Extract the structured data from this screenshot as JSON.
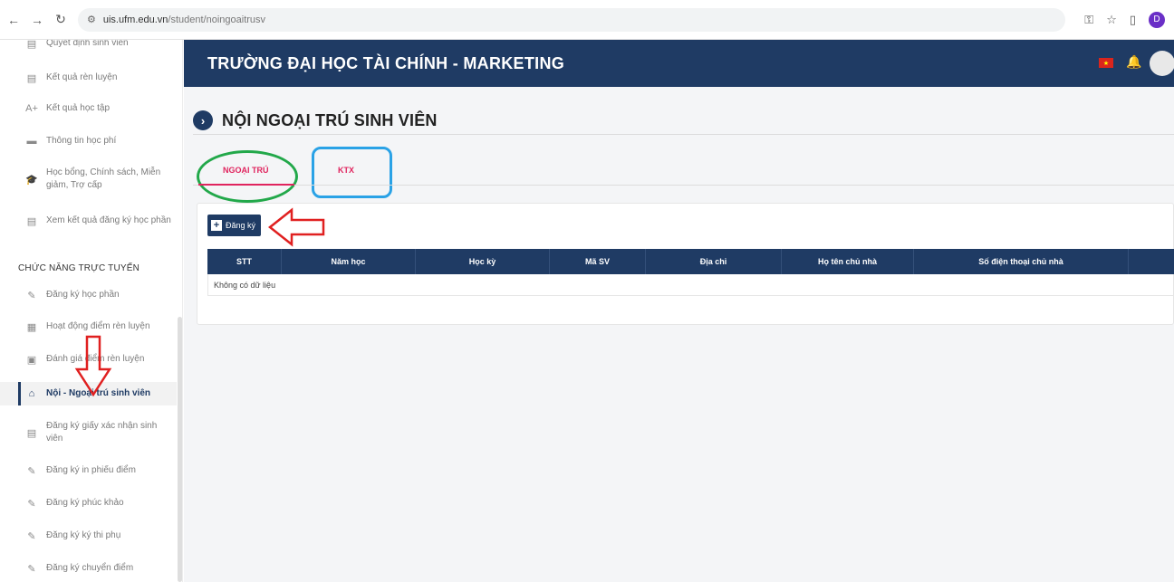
{
  "browser": {
    "url_host": "uis.ufm.edu.vn",
    "url_path": "/student/noingoaitrusv",
    "profile_initial": "D"
  },
  "header": {
    "title": "TRƯỜNG ĐẠI HỌC TÀI CHÍNH - MARKETING"
  },
  "sidebar": {
    "items_top": [
      {
        "label": "Quyết định sinh viên",
        "icon": "document-icon"
      },
      {
        "label": "Kết quả rèn luyện",
        "icon": "document-icon"
      },
      {
        "label": "Kết quả học tập",
        "icon": "text-a-plus-icon"
      },
      {
        "label": "Thông tin học phí",
        "icon": "card-icon"
      },
      {
        "label_line1": "Học bổng, Chính sách, Miễn",
        "label_line2": "giảm, Trợ cấp",
        "icon": "graduation-icon"
      },
      {
        "label": "Xem kết quả đăng ký học phần",
        "icon": "document-icon"
      }
    ],
    "section_title": "CHỨC NĂNG TRỰC TUYẾN",
    "items_online": [
      {
        "label": "Đăng ký học phần",
        "icon": "edit-icon"
      },
      {
        "label": "Hoạt động điểm rèn luyện",
        "icon": "users-icon"
      },
      {
        "label": "Đánh giá điểm rèn luyện",
        "icon": "document-icon"
      },
      {
        "label": "Nội - Ngoại trú sinh viên",
        "icon": "home-icon",
        "active": true
      },
      {
        "label_line1": "Đăng ký giấy xác nhận sinh",
        "label_line2": "viên",
        "icon": "document-plus-icon"
      },
      {
        "label": "Đăng ký in phiếu điểm",
        "icon": "edit-icon"
      },
      {
        "label": "Đăng ký phúc khảo",
        "icon": "edit-icon"
      },
      {
        "label": "Đăng ký ký thi phụ",
        "icon": "edit-icon"
      },
      {
        "label": "Đăng ký chuyển điểm",
        "icon": "edit-icon"
      }
    ]
  },
  "main": {
    "page_title": "NỘI NGOẠI TRÚ SINH VIÊN",
    "tabs": [
      {
        "label": "NGOẠI TRÚ",
        "active": true
      },
      {
        "label": "KTX",
        "active": false
      }
    ],
    "register_button": "Đăng ký",
    "table": {
      "columns": [
        "STT",
        "Năm học",
        "Học kỳ",
        "Mã SV",
        "Địa chỉ",
        "Họ tên chủ nhà",
        "Số điện thoại chủ nhà",
        ""
      ],
      "empty_text": "Không có dữ liệu"
    }
  },
  "colors": {
    "primary": "#1f3b64",
    "tab_active": "#e0245e",
    "annotation_red": "#e02020",
    "annotation_green": "#22a84a",
    "annotation_blue": "#2aa2e6"
  }
}
